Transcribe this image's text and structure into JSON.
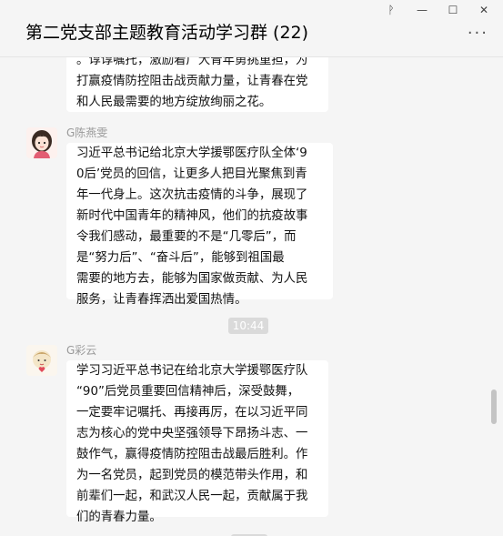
{
  "window": {
    "title": "第二党支部主题教育活动学习群 (22)",
    "controls": {
      "pin": "ᚹ",
      "minimize": "—",
      "maximize": "☐",
      "close": "✕"
    },
    "more": "···"
  },
  "messages": [
    {
      "sender": "",
      "lines": [
        "。谆谆嘱托，激励着广大青年勇挑重担，为",
        "打赢疫情防控阻击战贡献力量，让青春在党",
        "和人民最需要的地方绽放绚丽之花。"
      ]
    },
    {
      "sender": "G陈燕雯",
      "lines": [
        "习近平总书记给北京大学援鄂医疗队全体‘9",
        "0后’党员的回信，让更多人把目光聚焦到青",
        "年一代身上。这次抗击疫情的斗争，展现了",
        "新时代中国青年的精神风，他们的抗疫故事",
        "令我们感动，最重要的不是“几零后”，而",
        "是“努力后”、“奋斗后”，能够到祖国最",
        "需要的地方去，能够为国家做贡献、为人民",
        "服务，让青春挥洒出爱国热情。"
      ]
    },
    {
      "sender": "G彩云",
      "lines": [
        "学习习近平总书记在给北京大学援鄂医疗队",
        "“90”后党员重要回信精神后，深受鼓舞，",
        "一定要牢记嘱托、再接再厉，在以习近平同",
        "志为核心的党中央坚强领导下昂扬斗志、一",
        "鼓作气，赢得疫情防控阻击战最后胜利。作",
        "为一名党员，起到党员的模范带头作用，和",
        "前辈们一起，和武汉人民一起，贡献属于我",
        "们的青春力量。"
      ]
    }
  ],
  "timestamp": "10:44",
  "colors": {
    "background": "#f5f5f5",
    "bubble": "#ffffff",
    "sender": "#999999",
    "timestamp_bg": "#dadada"
  }
}
